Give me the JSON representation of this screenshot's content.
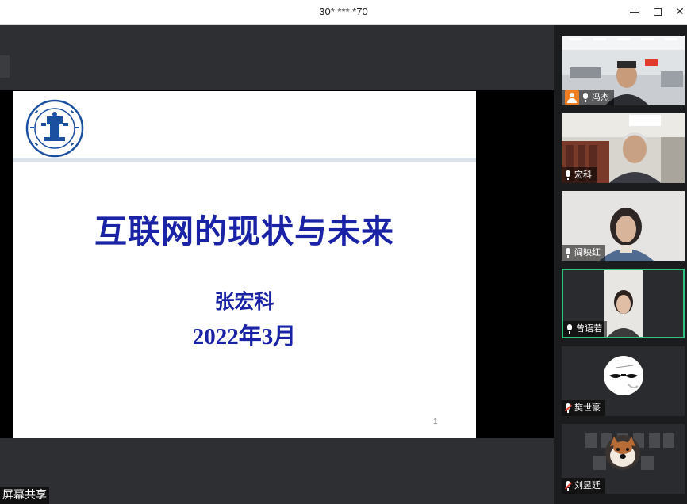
{
  "window": {
    "title": "30* *** *70"
  },
  "slide": {
    "title": "互联网的现状与未来",
    "author": "张宏科",
    "date": "2022年3月",
    "page_number": "1"
  },
  "share_label": "屏幕共享",
  "participants": [
    {
      "name": "冯杰",
      "host": true,
      "muted": false
    },
    {
      "name": "宏科",
      "host": false,
      "muted": false
    },
    {
      "name": "阎映红",
      "host": false,
      "muted": false
    },
    {
      "name": "曾语若",
      "host": false,
      "muted": false
    },
    {
      "name": "樊世豪",
      "host": false,
      "muted": true
    },
    {
      "name": "刘昱廷",
      "host": false,
      "muted": true
    }
  ],
  "colors": {
    "slide_text": "#1a23a6",
    "active_speaker": "#2ec27e",
    "host_badge": "#f07d1f",
    "muted": "#e0463a"
  }
}
